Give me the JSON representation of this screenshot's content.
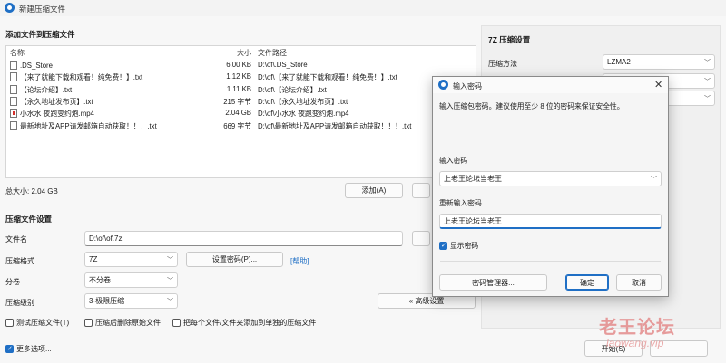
{
  "window": {
    "title": "新建压缩文件"
  },
  "files_section": {
    "title": "添加文件到压缩文件",
    "columns": {
      "name": "名称",
      "size": "大小",
      "path": "文件路径"
    },
    "rows": [
      {
        "name": ".DS_Store",
        "size": "6.00 KB",
        "path": "D:\\of\\.DS_Store",
        "icon": "file-icon"
      },
      {
        "name": "【来了就能下载和观看！纯免费！】.txt",
        "size": "1.12 KB",
        "path": "D:\\of\\【来了就能下载和观看！纯免费！】.txt",
        "icon": "file-icon"
      },
      {
        "name": "【论坛介绍】.txt",
        "size": "1.11 KB",
        "path": "D:\\of\\【论坛介绍】.txt",
        "icon": "file-icon"
      },
      {
        "name": "【永久地址发布页】.txt",
        "size": "215 字节",
        "path": "D:\\of\\【永久地址发布页】.txt",
        "icon": "file-icon"
      },
      {
        "name": "小水水 夜跑变约炮.mp4",
        "size": "2.04 GB",
        "path": "D:\\of\\小水水 夜跑变约炮.mp4",
        "icon": "video-file-icon"
      },
      {
        "name": "最新地址及APP请发邮箱自动获取！！！.txt",
        "size": "669 字节",
        "path": "D:\\of\\最新地址及APP请发邮箱自动获取！！！.txt",
        "icon": "file-icon"
      }
    ],
    "total_size": "总大小: 2.04 GB",
    "add_button": "添加(A)"
  },
  "compress_settings": {
    "title": "压缩文件设置",
    "filename_label": "文件名",
    "filename_value": "D:\\of\\of.7z",
    "format_label": "压缩格式",
    "format_value": "7Z",
    "set_password_button": "设置密码(P)...",
    "help_link": "[帮助]",
    "split_label": "分卷",
    "split_value": "不分卷",
    "level_label": "压缩级别",
    "level_value": "3-极限压缩",
    "advanced_button": "« 高级设置",
    "options": [
      {
        "label": "测试压缩文件(T)",
        "checked": false
      },
      {
        "label": "压缩后删除原始文件",
        "checked": false
      },
      {
        "label": "把每个文件/文件夹添加到单独的压缩文件",
        "checked": false
      }
    ]
  },
  "right_panel": {
    "title": "7Z 压缩设置",
    "method_label": "压缩方法",
    "method_value": "LZMA2"
  },
  "footer": {
    "more_options": "更多选项...",
    "more_options_checked": true,
    "start_button": "开始(S)"
  },
  "password_dialog": {
    "title": "输入密码",
    "description": "输入压缩包密码。建议使用至少 8 位的密码来保证安全性。",
    "password_label": "输入密码",
    "password_value": "上老王论坛当老王",
    "confirm_label": "重新输入密码",
    "confirm_value": "上老王论坛当老王",
    "show_password": "显示密码",
    "show_password_checked": true,
    "manager_button": "密码管理器...",
    "ok_button": "确定",
    "cancel_button": "取消"
  },
  "watermark": {
    "text": "老王论坛",
    "url": "laowang.vip"
  },
  "colors": {
    "accent": "#1f6fc5",
    "background": "#f3f3f3",
    "watermark": "#e48b8b"
  }
}
